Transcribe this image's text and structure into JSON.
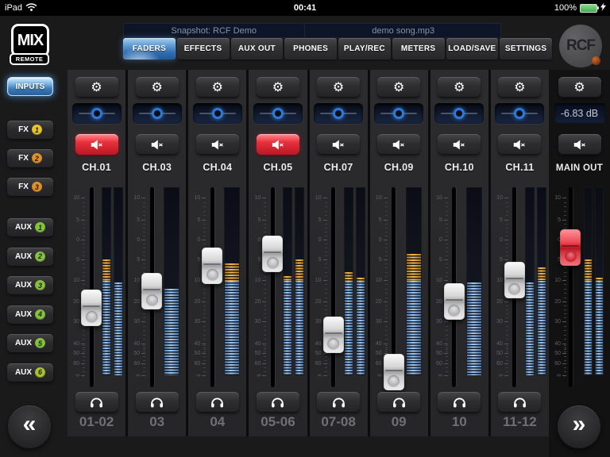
{
  "status_bar": {
    "device": "iPad",
    "time": "00:41",
    "battery_percent": "100%"
  },
  "header": {
    "logo_primary": "MIX",
    "logo_secondary": "REMOTE",
    "snapshot": "Snapshot: RCF Demo",
    "song": "demo song.mp3",
    "brand": "RCF",
    "tabs": [
      {
        "label": "FADERS",
        "active": true
      },
      {
        "label": "EFFECTS",
        "active": false
      },
      {
        "label": "AUX OUT",
        "active": false
      },
      {
        "label": "PHONES",
        "active": false
      },
      {
        "label": "PLAY/REC",
        "active": false
      },
      {
        "label": "METERS",
        "active": false
      },
      {
        "label": "LOAD/SAVE",
        "active": false
      },
      {
        "label": "SETTINGS",
        "active": false
      }
    ]
  },
  "sidebar": {
    "inputs_label": "INPUTS",
    "collapse_icon": "«",
    "fx_buttons": [
      {
        "label": "FX",
        "num": "1",
        "badge_color": "#e6c52f"
      },
      {
        "label": "FX",
        "num": "2",
        "badge_color": "#e0912a"
      },
      {
        "label": "FX",
        "num": "3",
        "badge_color": "#e0912a"
      }
    ],
    "aux_buttons": [
      {
        "label": "AUX",
        "num": "1",
        "badge_color": "#85c33e"
      },
      {
        "label": "AUX",
        "num": "2",
        "badge_color": "#85c33e"
      },
      {
        "label": "AUX",
        "num": "3",
        "badge_color": "#85c33e"
      },
      {
        "label": "AUX",
        "num": "4",
        "badge_color": "#85c33e"
      },
      {
        "label": "AUX",
        "num": "5",
        "badge_color": "#85c33e"
      },
      {
        "label": "AUX",
        "num": "6",
        "badge_color": "#aac32f"
      }
    ]
  },
  "mixer": {
    "scale_labels": [
      "10",
      "5",
      "0",
      "5",
      "10",
      "20",
      "30",
      "40",
      "50",
      "60",
      "∞"
    ],
    "orange_above_db": -10.5,
    "channels": [
      {
        "name": "CH.01",
        "pair": "01-02",
        "muted": true,
        "fader_db": -23,
        "meters": [
          -5,
          -11
        ]
      },
      {
        "name": "CH.03",
        "pair": "03",
        "muted": false,
        "fader_db": -15,
        "meters": [
          -14
        ]
      },
      {
        "name": "CH.04",
        "pair": "04",
        "muted": false,
        "fader_db": -6.5,
        "meters": [
          -6
        ]
      },
      {
        "name": "CH.05",
        "pair": "05-06",
        "muted": true,
        "fader_db": -3.5,
        "meters": [
          -9,
          -5
        ]
      },
      {
        "name": "CH.07",
        "pair": "07-08",
        "muted": false,
        "fader_db": -36,
        "meters": [
          -8,
          -9.5
        ]
      },
      {
        "name": "CH.09",
        "pair": "09",
        "muted": false,
        "fader_db": -75,
        "meters": [
          -3.5
        ]
      },
      {
        "name": "CH.10",
        "pair": "10",
        "muted": false,
        "fader_db": -20,
        "meters": [
          -11
        ]
      },
      {
        "name": "CH.11",
        "pair": "11-12",
        "muted": false,
        "fader_db": -10,
        "meters": [
          -11,
          -7
        ]
      }
    ],
    "main_out": {
      "name": "MAIN OUT",
      "level_display": "-6.83 dB",
      "muted": false,
      "fader_db": -2,
      "meters": [
        -5,
        -9.5
      ],
      "expand_icon": "»"
    }
  },
  "icons": {
    "gear": "⚙",
    "mute": "speaker-muted",
    "phones": "headphones",
    "pan": "pan-dot",
    "wifi": "wifi-arcs",
    "battery": "battery-charging-green",
    "prev": "double-chevron-left",
    "next": "double-chevron-right"
  },
  "colors": {
    "tab_active": "#4a8fd0",
    "meter_blue": "#7fa9dc",
    "meter_orange": "#e8a23c",
    "mute_active": "#d42030",
    "inputs_glow": "#5c9ed6",
    "battery": "#53d769",
    "main_knob": "#d8303e"
  }
}
